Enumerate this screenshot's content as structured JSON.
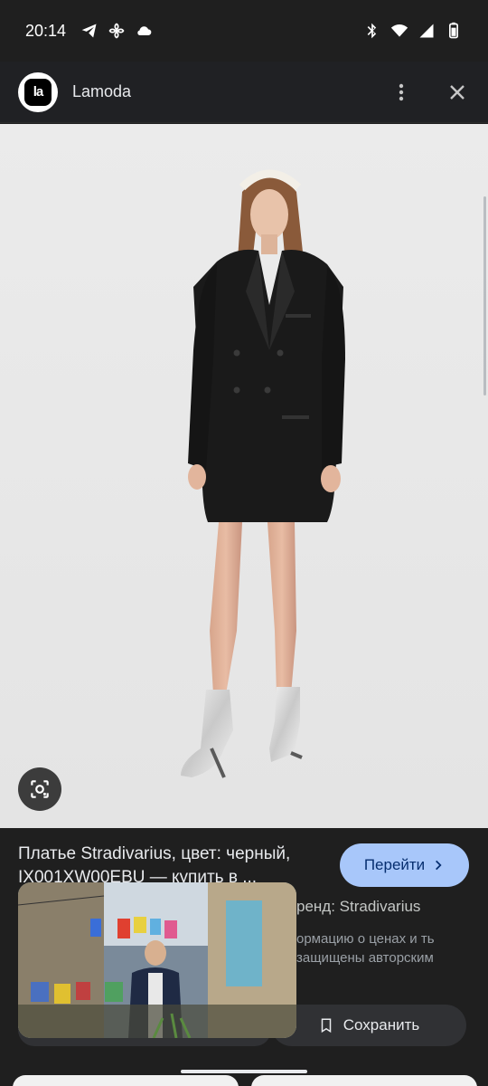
{
  "status_bar": {
    "time": "20:14"
  },
  "header": {
    "logo_text": "la",
    "site_name": "Lamoda"
  },
  "product": {
    "title": "Платье Stradivarius, цвет: черный, IX001XW00EBU — купить в ...",
    "go_button": "Перейти",
    "brand": "ренд: Stradivarius",
    "copyright": "ормацию о ценах и ть защищены авторским",
    "save_button": "Сохранить"
  },
  "colors": {
    "accent_button": "#a8c7fa",
    "background": "#1f1f1f"
  }
}
